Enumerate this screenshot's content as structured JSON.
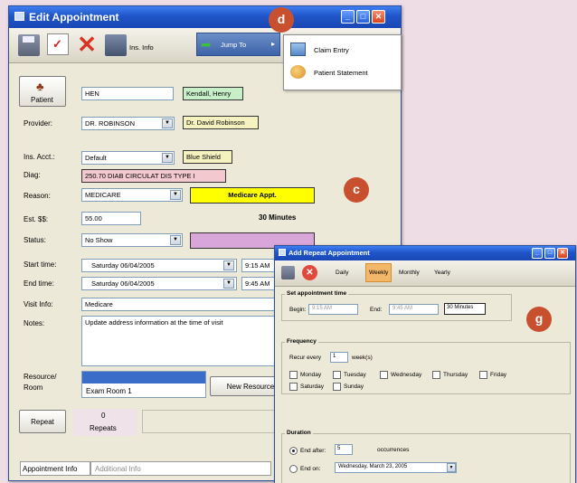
{
  "markers": {
    "d": "d",
    "c": "c",
    "g": "g"
  },
  "edit_window": {
    "title": "Edit Appointment",
    "toolbar": {
      "ins_info_label": "Ins. Info",
      "jump_to_label": "Jump To"
    },
    "jump_menu": {
      "items": [
        {
          "label": "Claim Entry"
        },
        {
          "label": "Patient Statement"
        }
      ]
    },
    "patient": {
      "button_label": "Patient",
      "code": "HEN",
      "name": "Kendall, Henry"
    },
    "provider": {
      "label": "Provider:",
      "value": "DR. ROBINSON",
      "full_name": "Dr. David Robinson"
    },
    "ins_acct": {
      "label": "Ins. Acct.:",
      "value": "Default",
      "carrier": "Blue Shield"
    },
    "diag": {
      "label": "Diag:",
      "value": "250.70 DIAB CIRCULAT DIS TYPE I"
    },
    "reason": {
      "label": "Reason:",
      "value": "MEDICARE",
      "appt_type": "Medicare Appt."
    },
    "est": {
      "label": "Est. $$:",
      "value": "55.00",
      "duration": "30 Minutes"
    },
    "status": {
      "label": "Status:",
      "value": "No Show"
    },
    "start": {
      "label": "Start time:",
      "date": "Saturday  06/04/2005",
      "time": "9:15 AM"
    },
    "end": {
      "label": "End time:",
      "date": "Saturday  06/04/2005",
      "time": "9:45 AM"
    },
    "visit": {
      "label": "Visit Info:",
      "value": "Medicare"
    },
    "notes": {
      "label": "Notes:",
      "value": "Update address information at the time of visit"
    },
    "resource": {
      "label": "Resource/\nRoom",
      "value": "Exam Room 1",
      "new_button": "New Resource"
    },
    "repeat": {
      "button_label": "Repeat",
      "count": "0",
      "count_label": "Repeats"
    },
    "tabs": [
      {
        "label": "Appointment Info"
      },
      {
        "label": "Additional Info"
      }
    ],
    "colors": {
      "patient_name_bg": "#c8f0c8",
      "carrier_bg": "#f6f2c0",
      "diag_bg": "#f3c9cf",
      "appt_type_bg": "#ffff00",
      "status_swatch": "#d9a6d9"
    }
  },
  "repeat_window": {
    "title": "Add Repeat Appointment",
    "tabs": [
      {
        "label": "Daily"
      },
      {
        "label": "Weekly"
      },
      {
        "label": "Monthly"
      },
      {
        "label": "Yearly"
      }
    ],
    "active_tab": "Weekly",
    "set_time": {
      "title": "Set appointment time",
      "begin_label": "Begin:",
      "begin_value": "9:15 AM",
      "end_label": "End:",
      "end_value": "9:45 AM",
      "duration": "30 Minutes"
    },
    "frequency": {
      "title": "Frequency",
      "recur_label": "Recur every",
      "recur_value": "1",
      "recur_unit": "week(s)",
      "days": [
        {
          "label": "Monday"
        },
        {
          "label": "Tuesday"
        },
        {
          "label": "Wednesday"
        },
        {
          "label": "Thursday"
        },
        {
          "label": "Friday"
        },
        {
          "label": "Saturday"
        },
        {
          "label": "Sunday"
        }
      ]
    },
    "duration": {
      "title": "Duration",
      "end_after_label": "End after:",
      "end_after_value": "5",
      "occurrences_label": "occurrences",
      "end_on_label": "End on:",
      "end_on_value": "Wednesday,    March    23, 2005"
    }
  }
}
